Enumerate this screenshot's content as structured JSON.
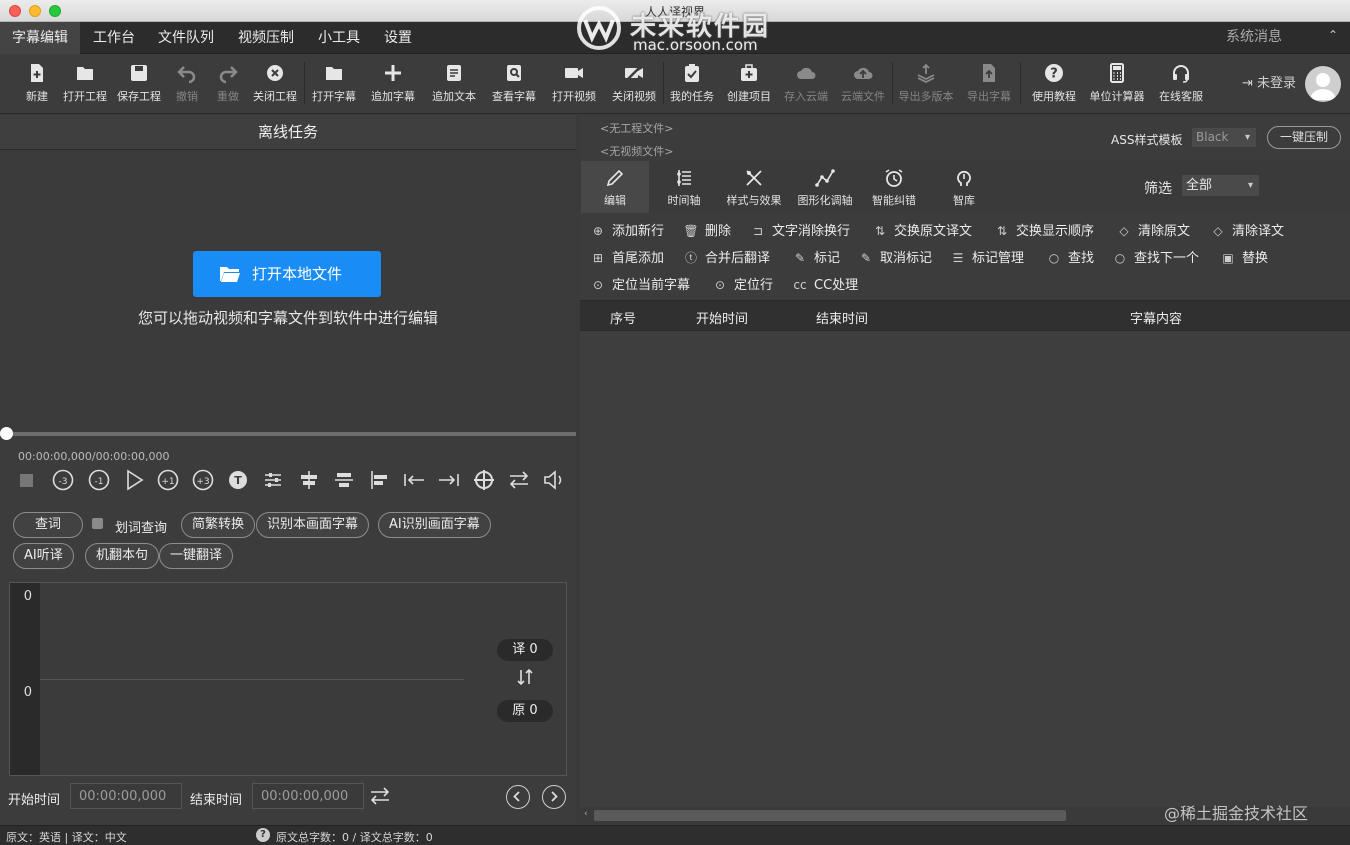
{
  "window": {
    "title": "人人译视界"
  },
  "watermark": {
    "brand": "未来软件园",
    "domain": "mac.orsoon.com"
  },
  "menu": {
    "items": [
      "字幕编辑",
      "工作台",
      "文件队列",
      "视频压制",
      "小工具",
      "设置"
    ],
    "active": "字幕编辑",
    "system_message": "系统消息",
    "collapse": "⌃"
  },
  "toolbar": {
    "tools": [
      {
        "label": "新建",
        "icon": "new-file-icon"
      },
      {
        "label": "打开工程",
        "icon": "open-folder-icon"
      },
      {
        "label": "保存工程",
        "icon": "save-icon"
      },
      {
        "label": "撤销",
        "icon": "undo-icon",
        "disabled": true
      },
      {
        "label": "重做",
        "icon": "redo-icon",
        "disabled": true
      },
      {
        "label": "关闭工程",
        "icon": "close-circle-icon"
      },
      {
        "label": "打开字幕",
        "icon": "open-subtitle-icon"
      },
      {
        "label": "追加字幕",
        "icon": "plus-icon"
      },
      {
        "label": "追加文本",
        "icon": "append-text-icon"
      },
      {
        "label": "查看字幕",
        "icon": "view-subtitle-icon"
      },
      {
        "label": "打开视频",
        "icon": "video-camera-icon"
      },
      {
        "label": "关闭视频",
        "icon": "video-off-icon"
      },
      {
        "label": "我的任务",
        "icon": "clipboard-check-icon"
      },
      {
        "label": "创建项目",
        "icon": "create-project-icon"
      },
      {
        "label": "存入云端",
        "icon": "cloud-save-icon",
        "disabled": true
      },
      {
        "label": "云端文件",
        "icon": "cloud-upload-icon",
        "disabled": true
      },
      {
        "label": "导出多版本",
        "icon": "export-layers-icon",
        "disabled": true
      },
      {
        "label": "导出字幕",
        "icon": "export-file-icon",
        "disabled": true
      },
      {
        "label": "使用教程",
        "icon": "help-circle-icon"
      },
      {
        "label": "单位计算器",
        "icon": "calculator-icon"
      },
      {
        "label": "在线客服",
        "icon": "headset-icon"
      }
    ],
    "login_label": "未登录"
  },
  "left": {
    "header": "离线任务",
    "open_button": "打开本地文件",
    "drag_tip": "您可以拖动视频和字幕文件到软件中进行编辑",
    "timecode": "00:00:00,000/00:00:00,000",
    "playback_progress": 0,
    "pills_row1": [
      "查词",
      "简繁转换",
      "识别本画面字幕",
      "AI识别画面字幕"
    ],
    "checkbox_label": "划词查询",
    "pills_row2": [
      "AI听译",
      "机翻本句",
      "一键翻译"
    ],
    "line_top": "0",
    "line_bottom": "0",
    "translation_count": "译 0",
    "original_count": "原 0",
    "start_label": "开始时间",
    "start_value": "00:00:00,000",
    "end_label": "结束时间",
    "end_value": "00:00:00,000"
  },
  "right": {
    "no_project": "<无工程文件>",
    "no_video": "<无视频文件>",
    "ass_label": "ASS样式模板",
    "ass_value": "Black",
    "one_click_compress": "一键压制",
    "tabs": [
      {
        "label": "编辑",
        "icon": "pencil-icon"
      },
      {
        "label": "时间轴",
        "icon": "timeline-icon"
      },
      {
        "label": "样式与效果",
        "icon": "brush-icon"
      },
      {
        "label": "图形化调轴",
        "icon": "graph-icon"
      },
      {
        "label": "智能纠错",
        "icon": "alarm-icon"
      },
      {
        "label": "智库",
        "icon": "brain-icon"
      }
    ],
    "filter_label": "筛选",
    "filter_value": "全部",
    "actions_row1": [
      {
        "label": "添加新行",
        "icon": "⊕"
      },
      {
        "label": "删除",
        "icon": "🗑"
      },
      {
        "label": "文字消除换行",
        "icon": "⊐"
      },
      {
        "label": "交换原文译文",
        "icon": "⇅"
      },
      {
        "label": "交换显示顺序",
        "icon": "⇅"
      },
      {
        "label": "清除原文",
        "icon": "◇"
      },
      {
        "label": "清除译文",
        "icon": "◇"
      }
    ],
    "actions_row2": [
      {
        "label": "首尾添加",
        "icon": "⊞"
      },
      {
        "label": "合并后翻译",
        "icon": "ⓣ"
      },
      {
        "label": "标记",
        "icon": "✎"
      },
      {
        "label": "取消标记",
        "icon": "✎"
      },
      {
        "label": "标记管理",
        "icon": "☰"
      },
      {
        "label": "查找",
        "icon": "○"
      },
      {
        "label": "查找下一个",
        "icon": "○"
      },
      {
        "label": "替换",
        "icon": "▣"
      }
    ],
    "actions_row3": [
      {
        "label": "定位当前字幕",
        "icon": "⊙"
      },
      {
        "label": "定位行",
        "icon": "⊙"
      },
      {
        "label": "CC处理",
        "icon": "cc"
      }
    ],
    "columns": [
      "序号",
      "开始时间",
      "结束时间",
      "字幕内容"
    ]
  },
  "status": {
    "languages": "原文：英语 | 译文：中文",
    "counts": "原文总字数：0 / 译文总字数：0",
    "help": "?"
  },
  "site_watermark": "@稀土掘金技术社区",
  "colors": {
    "accent": "#1a8cf5",
    "background": "#3c3c3c"
  }
}
